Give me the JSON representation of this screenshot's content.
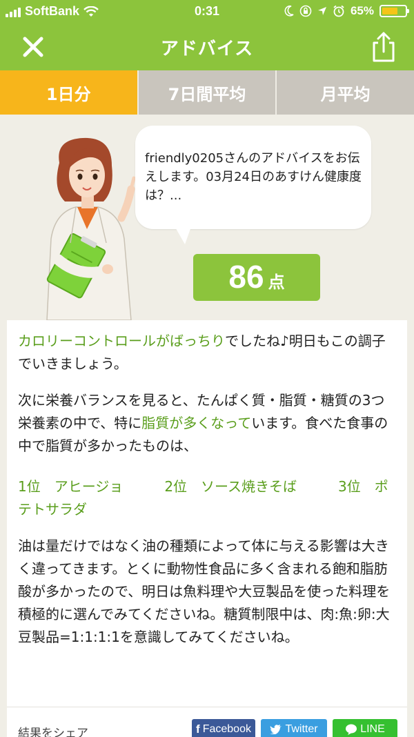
{
  "status_bar": {
    "carrier": "SoftBank",
    "time": "0:31",
    "battery": "65%",
    "battery_level": 0.65
  },
  "nav": {
    "title": "アドバイス",
    "close_icon": "close-icon",
    "share_icon": "share-icon"
  },
  "tabs": [
    {
      "label": "1日分",
      "active": true
    },
    {
      "label": "7日間平均",
      "active": false
    },
    {
      "label": "月平均",
      "active": false
    }
  ],
  "advice": {
    "bubble_text": "friendly0205さんのアドバイスをお伝えします。03月24日のあすけん健康度は？...",
    "score": "86",
    "score_unit": "点",
    "p1_highlight": "カロリーコントロールがばっちり",
    "p1_rest": "でしたね♪明日もこの調子でいきましょう。",
    "p2_a": "次に栄養バランスを見ると、たんぱく質・脂質・糖質の3つ栄養素の中で、特に",
    "p2_highlight": "脂質が多くなって",
    "p2_b": "います。食べた食事の中で脂質が多かったものは、",
    "ranking": "1位　アヒージョ　　　2位　ソース焼きそば　　　3位　ポテトサラダ",
    "p3": "油は量だけではなく油の種類によって体に与える影響は大きく違ってきます。とくに動物性食品に多く含まれる飽和脂肪酸が多かったので、明日は魚料理や大豆製品を使った料理を積極的に選んでみてくださいね。糖質制限中は、肉:魚:卵:大豆製品=1:1:1:1を意識してみてくださいね。"
  },
  "share": {
    "label": "結果をシェア",
    "facebook": "Facebook",
    "twitter": "Twitter",
    "line": "LINE"
  },
  "colors": {
    "brand_green": "#8cc43c",
    "tab_active": "#f7b51b",
    "highlight_text": "#5a9e1c"
  }
}
